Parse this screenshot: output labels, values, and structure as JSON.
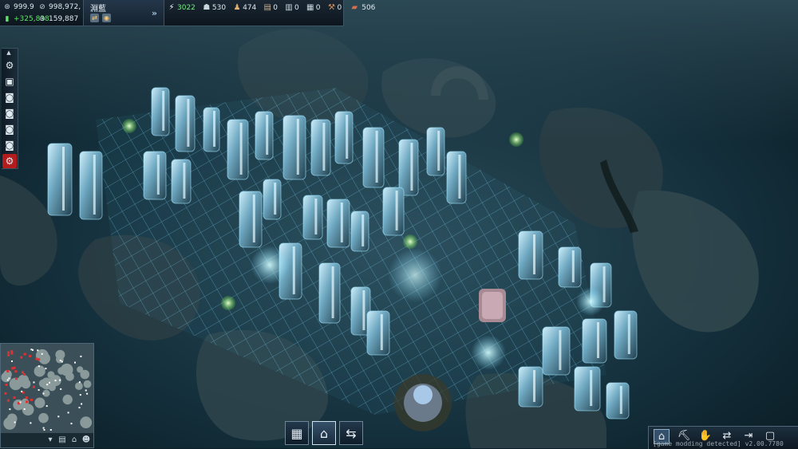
{
  "money": {
    "credits": "999.9",
    "credits_secondary": "998,972,",
    "income": "+325,838",
    "balance": "159,887"
  },
  "faction": {
    "name": "淵藍"
  },
  "resources": {
    "energy": "3022",
    "workforce": "530",
    "resource2": "474",
    "resource3": "0",
    "resource4": "0",
    "resource5": "0",
    "resource6": "0",
    "resource7": "506"
  },
  "status": {
    "mod_text": "[game modding detected] v2.00.7780"
  },
  "colors": {
    "energy_green": "#6ff07a",
    "income_green": "#5ee66a",
    "alert_red": "#b21c1c",
    "city_glow": "#7fdcff"
  },
  "icons": {
    "left_toolbar": [
      "gear-icon",
      "save-icon",
      "camera-icon",
      "camera-icon",
      "camera-icon",
      "camera-icon",
      "settings-gear-icon"
    ],
    "bottom_center": [
      "build-menu-icon",
      "home-icon",
      "trade-icon"
    ],
    "bottom_right": [
      "home-icon",
      "pickaxe-icon",
      "handshake-icon",
      "swap-icon",
      "export-icon",
      "window-icon"
    ]
  }
}
